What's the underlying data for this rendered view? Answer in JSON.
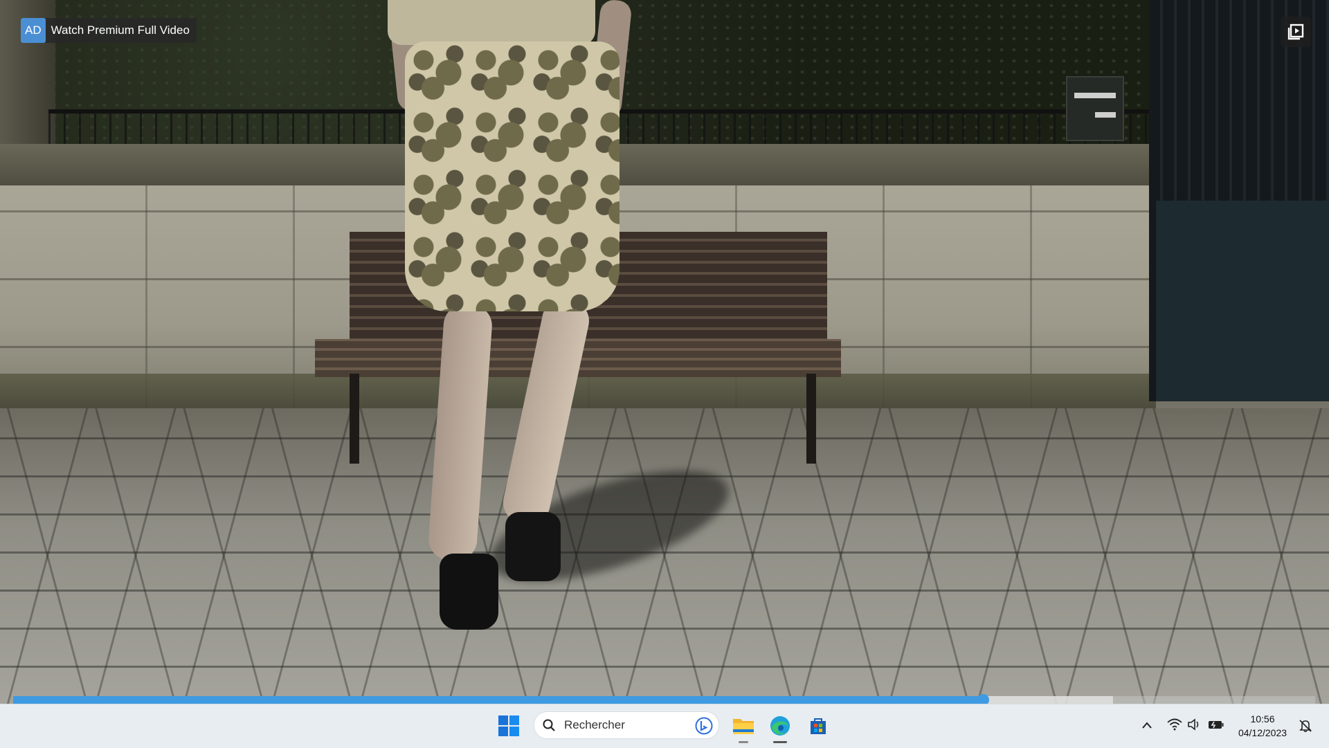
{
  "overlay": {
    "ad_tag": "AD",
    "ad_text": "Watch Premium Full Video",
    "playlist_icon": "playlist-play-icon"
  },
  "player": {
    "progress_played": 0.745,
    "progress_buffered": 0.845,
    "accent_color": "#3f9ae2"
  },
  "taskbar": {
    "search_placeholder": "Rechercher",
    "apps": [
      "start-icon",
      "file-explorer-icon",
      "edge-icon",
      "store-icon"
    ],
    "tray_icons": [
      "chevron-up-icon",
      "wifi-icon",
      "volume-icon",
      "battery-icon",
      "notification-icon"
    ],
    "time": "10:56",
    "date": "04/12/2023"
  }
}
